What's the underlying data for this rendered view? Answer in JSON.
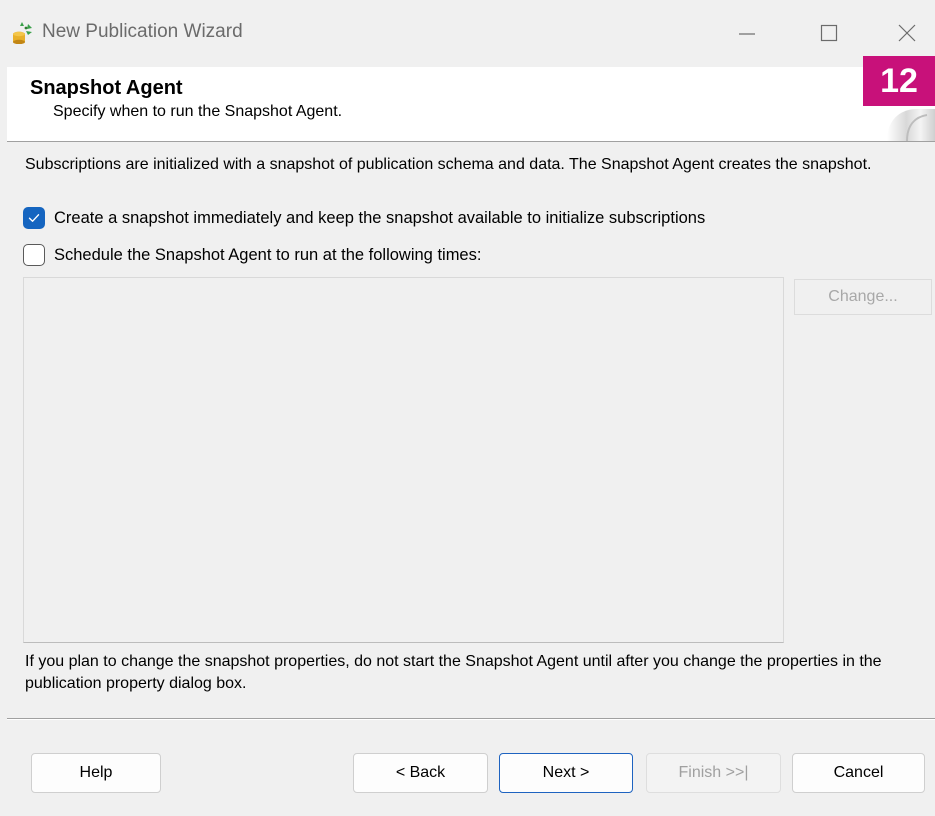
{
  "window": {
    "title": "New Publication Wizard"
  },
  "header": {
    "title": "Snapshot Agent",
    "subtitle": "Specify when to run the Snapshot Agent.",
    "step_badge": "12",
    "badge_color": "#c8117a"
  },
  "body": {
    "description": "Subscriptions are initialized with a snapshot of publication schema and data. The Snapshot Agent creates the snapshot.",
    "options": [
      {
        "label": "Create a snapshot immediately and keep the snapshot available to initialize subscriptions",
        "checked": true
      },
      {
        "label": "Schedule the Snapshot Agent to run at the following times:",
        "checked": false
      }
    ],
    "change_button_label": "Change...",
    "note": "If you plan to change the snapshot properties, do not start the Snapshot Agent until after you change the properties in the publication property dialog box."
  },
  "footer": {
    "help_label": "Help",
    "back_label": "< Back",
    "next_label": "Next >",
    "finish_label": "Finish >>|",
    "cancel_label": "Cancel"
  },
  "colors": {
    "accent": "#1565c0",
    "disabled_text": "#a8a8a8"
  }
}
